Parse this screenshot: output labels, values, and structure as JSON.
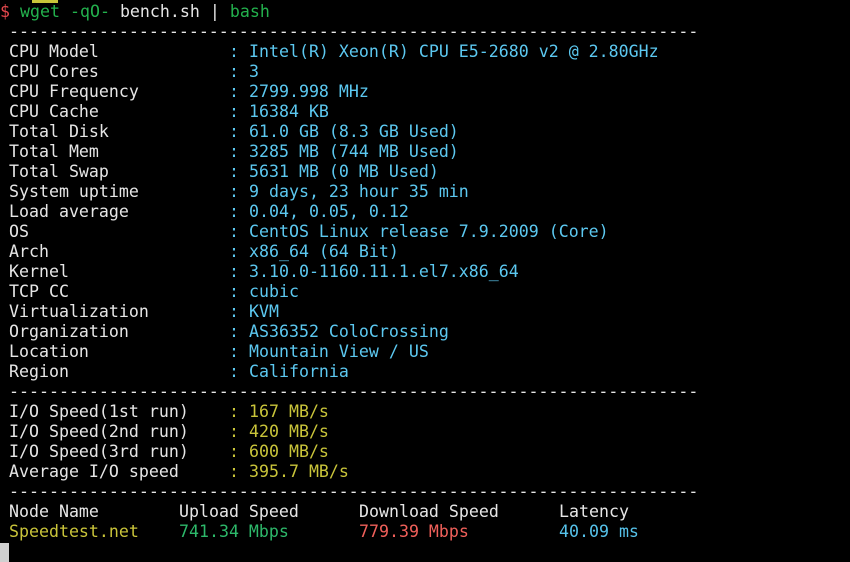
{
  "prompt": {
    "symbol": "$",
    "command": "wget",
    "flags": "-qO-",
    "argument": "bench.sh",
    "pipe": "|",
    "program": "bash"
  },
  "separator": "-------------------------------------------------------------------------",
  "colon": ":",
  "system_info": [
    {
      "label": "CPU Model",
      "value": "Intel(R) Xeon(R) CPU E5-2680 v2 @ 2.80GHz"
    },
    {
      "label": "CPU Cores",
      "value": "3"
    },
    {
      "label": "CPU Frequency",
      "value": "2799.998 MHz"
    },
    {
      "label": "CPU Cache",
      "value": "16384 KB"
    },
    {
      "label": "Total Disk",
      "value": "61.0 GB (8.3 GB Used)"
    },
    {
      "label": "Total Mem",
      "value": "3285 MB (744 MB Used)"
    },
    {
      "label": "Total Swap",
      "value": "5631 MB (0 MB Used)"
    },
    {
      "label": "System uptime",
      "value": "9 days, 23 hour 35 min"
    },
    {
      "label": "Load average",
      "value": "0.04, 0.05, 0.12"
    },
    {
      "label": "OS",
      "value": "CentOS Linux release 7.9.2009 (Core)"
    },
    {
      "label": "Arch",
      "value": "x86_64 (64 Bit)"
    },
    {
      "label": "Kernel",
      "value": "3.10.0-1160.11.1.el7.x86_64"
    },
    {
      "label": "TCP CC",
      "value": "cubic"
    },
    {
      "label": "Virtualization",
      "value": "KVM"
    },
    {
      "label": "Organization",
      "value": "AS36352 ColoCrossing"
    },
    {
      "label": "Location",
      "value": "Mountain View / US"
    },
    {
      "label": "Region",
      "value": "California"
    }
  ],
  "io_speed": [
    {
      "label": "I/O Speed(1st run)",
      "value": "167 MB/s"
    },
    {
      "label": "I/O Speed(2nd run)",
      "value": "420 MB/s"
    },
    {
      "label": "I/O Speed(3rd run)",
      "value": "600 MB/s"
    },
    {
      "label": "Average I/O speed",
      "value": "395.7 MB/s"
    }
  ],
  "speedtest": {
    "headers": {
      "node": "Node Name",
      "upload": "Upload Speed",
      "download": "Download Speed",
      "latency": "Latency"
    },
    "rows": [
      {
        "node": "Speedtest.net",
        "upload": "741.34 Mbps",
        "download": "779.39 Mbps",
        "latency": "40.09 ms"
      }
    ]
  },
  "colors": {
    "background": "#000000",
    "text": "#e6e6e6",
    "value": "#5cc8f0",
    "io_value": "#c9c43a",
    "prompt": "#e5484d",
    "command": "#23b14d"
  }
}
